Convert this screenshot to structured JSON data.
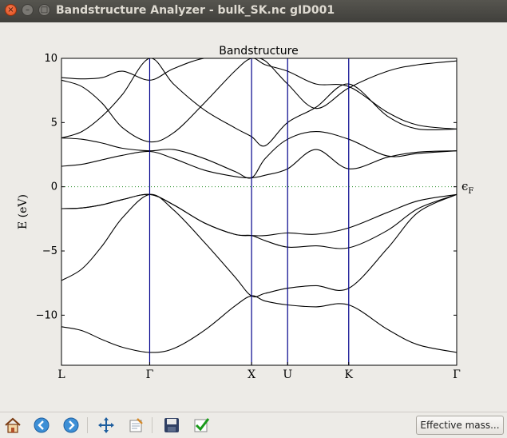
{
  "window": {
    "title": "Bandstructure Analyzer - bulk_SK.nc gID001",
    "controls": {
      "close": "×",
      "minimize": "–",
      "maximize": "□"
    }
  },
  "toolbar": {
    "icons": [
      "home-icon",
      "back-arrow-icon",
      "forward-arrow-icon",
      "pan-move-icon",
      "subplot-config-icon",
      "save-floppy-icon",
      "check-icon"
    ],
    "effective_mass_label": "Effective mass..."
  },
  "chart_data": {
    "type": "line",
    "title": "Bandstructure",
    "ylabel": "E (eV)",
    "fermi_label": "ϵ",
    "fermi_label_sub": "F",
    "fermi_level": 0,
    "ylim": [
      -13.9,
      10
    ],
    "yticks": [
      10,
      5,
      0,
      -5,
      -10
    ],
    "ytick_labels": [
      "10",
      "5",
      "0",
      "−5",
      "−10"
    ],
    "kpoints": [
      {
        "label": "L",
        "x": 0
      },
      {
        "label": "Γ",
        "x": 0.866
      },
      {
        "label": "X",
        "x": 1.866
      },
      {
        "label": "U",
        "x": 2.22
      },
      {
        "label": "K",
        "x": 2.82
      },
      {
        "label": "Γ",
        "x": 3.88
      }
    ],
    "colors": {
      "bands": "#000000",
      "kpoint_lines": "#00008b",
      "fermi_line": "#228b22"
    },
    "series": [
      {
        "x": [
          0,
          0.2,
          0.4,
          0.6,
          0.866,
          1.1,
          1.4,
          1.7,
          1.866,
          2.0,
          2.22,
          2.5,
          2.82,
          3.2,
          3.5,
          3.88
        ],
        "values": [
          -10.9,
          -11.2,
          -11.9,
          -12.5,
          -12.9,
          -12.6,
          -11.2,
          -9.3,
          -8.5,
          -8.9,
          -9.2,
          -9.35,
          -9.2,
          -11.1,
          -12.3,
          -12.9
        ]
      },
      {
        "x": [
          0,
          0.2,
          0.4,
          0.6,
          0.866,
          1.1,
          1.4,
          1.7,
          1.866,
          2.0,
          2.22,
          2.5,
          2.82,
          3.2,
          3.5,
          3.88
        ],
        "values": [
          -7.3,
          -6.4,
          -4.6,
          -2.4,
          -0.6,
          -1.8,
          -4.3,
          -7.0,
          -8.5,
          -8.3,
          -7.9,
          -7.7,
          -7.9,
          -4.8,
          -2.0,
          -0.6
        ]
      },
      {
        "x": [
          0,
          0.2,
          0.4,
          0.6,
          0.866,
          1.1,
          1.4,
          1.7,
          1.866,
          2.0,
          2.22,
          2.5,
          2.82,
          3.2,
          3.5,
          3.88
        ],
        "values": [
          -1.7,
          -1.65,
          -1.4,
          -1.0,
          -0.6,
          -1.4,
          -2.8,
          -3.7,
          -3.8,
          -4.2,
          -4.7,
          -4.6,
          -4.75,
          -3.4,
          -1.7,
          -0.6
        ]
      },
      {
        "x": [
          0,
          0.2,
          0.4,
          0.6,
          0.866,
          1.1,
          1.4,
          1.7,
          1.866,
          2.0,
          2.22,
          2.5,
          2.82,
          3.2,
          3.5,
          3.88
        ],
        "values": [
          -1.7,
          -1.65,
          -1.4,
          -1.0,
          -0.6,
          -1.4,
          -2.8,
          -3.7,
          -3.8,
          -3.8,
          -3.6,
          -3.7,
          -3.2,
          -2.0,
          -1.1,
          -0.6
        ]
      },
      {
        "x": [
          0,
          0.2,
          0.4,
          0.6,
          0.866,
          1.1,
          1.4,
          1.7,
          1.866,
          2.0,
          2.22,
          2.5,
          2.82,
          3.2,
          3.5,
          3.88
        ],
        "values": [
          1.6,
          1.75,
          2.1,
          2.45,
          2.75,
          2.2,
          1.3,
          0.8,
          0.7,
          0.9,
          1.4,
          2.9,
          1.4,
          2.3,
          2.7,
          2.8
        ]
      },
      {
        "x": [
          0,
          0.2,
          0.4,
          0.6,
          0.866,
          1.1,
          1.4,
          1.7,
          1.866,
          2.0,
          2.22,
          2.5,
          2.82,
          3.2,
          3.5,
          3.88
        ],
        "values": [
          3.8,
          3.7,
          3.4,
          3.0,
          2.8,
          2.9,
          2.2,
          1.2,
          0.7,
          2.2,
          3.7,
          4.3,
          3.7,
          2.4,
          2.6,
          2.8
        ]
      },
      {
        "x": [
          0,
          0.2,
          0.4,
          0.6,
          0.866,
          1.1,
          1.4,
          1.7,
          1.866,
          2.0,
          2.22,
          2.5,
          2.82,
          3.2,
          3.5,
          3.88
        ],
        "values": [
          3.8,
          4.3,
          5.5,
          7.2,
          10.0,
          8.0,
          6.0,
          4.6,
          3.9,
          3.2,
          5.0,
          6.2,
          8.0,
          5.5,
          4.5,
          4.5
        ]
      },
      {
        "x": [
          0,
          0.2,
          0.4,
          0.6,
          0.866,
          1.1,
          1.4,
          1.7,
          1.866,
          2.0,
          2.22,
          2.5,
          2.82,
          3.2,
          3.5,
          3.88
        ],
        "values": [
          8.3,
          7.8,
          6.5,
          4.6,
          3.5,
          4.2,
          6.5,
          9.0,
          10.0,
          9.5,
          9.0,
          8.0,
          7.8,
          5.8,
          4.8,
          4.5
        ]
      },
      {
        "x": [
          0,
          0.2,
          0.4,
          0.6,
          0.866,
          1.1,
          1.4,
          1.7,
          1.866,
          2.0,
          2.22,
          2.5,
          2.82,
          3.2,
          3.5,
          3.88
        ],
        "values": [
          8.5,
          8.4,
          8.5,
          9.0,
          8.3,
          9.2,
          10.0,
          10.0,
          10.0,
          9.8,
          8.0,
          6.1,
          7.7,
          9.0,
          9.5,
          9.8
        ]
      }
    ]
  }
}
